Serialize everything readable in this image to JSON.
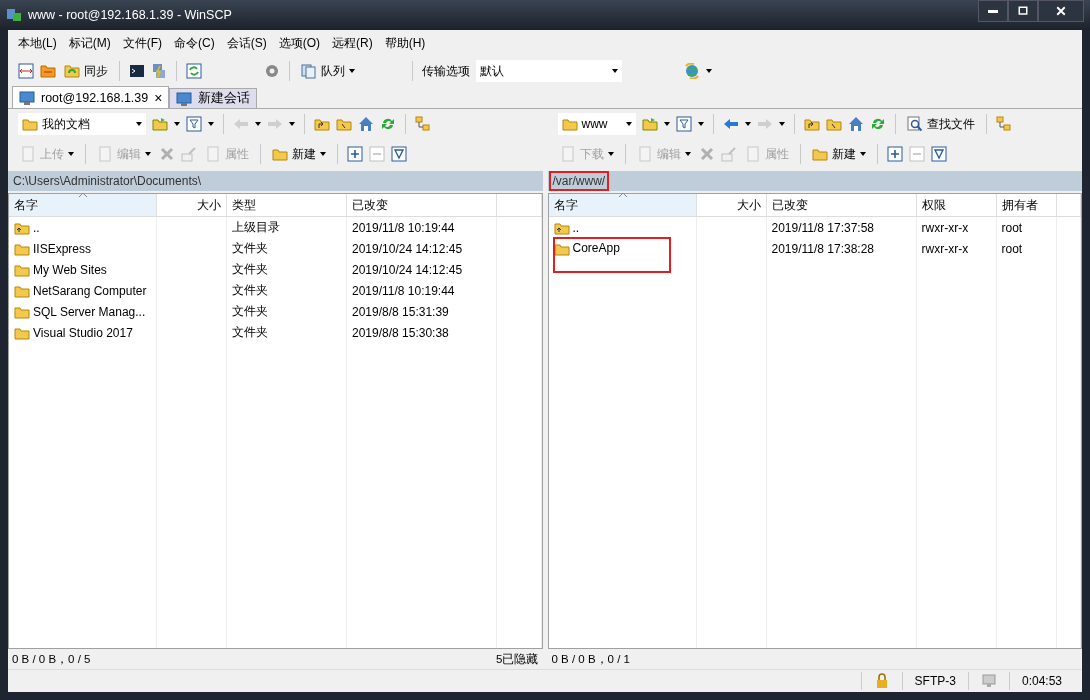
{
  "window": {
    "title": "www - root@192.168.1.39 - WinSCP"
  },
  "menu": [
    "本地(L)",
    "标记(M)",
    "文件(F)",
    "命令(C)",
    "会话(S)",
    "选项(O)",
    "远程(R)",
    "帮助(H)"
  ],
  "toolbar": {
    "sync_label": "同步",
    "queue_label": "队列",
    "transfer_label": "传输选项",
    "transfer_value": "默认"
  },
  "session_tabs": [
    {
      "label": "root@192.168.1.39",
      "selected": true,
      "closable": true,
      "close_glyph": "×"
    },
    {
      "label": "新建会话",
      "selected": false,
      "closable": false
    }
  ],
  "panels": [
    {
      "location": "我的文档",
      "back_disabled": true,
      "actions": [
        {
          "label": "上传",
          "disabled": true
        },
        {
          "label": "编辑",
          "disabled": true
        },
        {
          "label": "属性",
          "disabled": true
        },
        {
          "label": "新建",
          "disabled": false
        }
      ],
      "path": "C:\\Users\\Administrator\\Documents\\",
      "path_highlighted": false,
      "columns": [
        {
          "label": "名字",
          "kind": "name",
          "sorted": true
        },
        {
          "label": "大小",
          "kind": "size",
          "sorted": false
        },
        {
          "label": "类型",
          "kind": "type",
          "sorted": false
        },
        {
          "label": "已改变",
          "kind": "date",
          "sorted": false
        }
      ],
      "rows": [
        {
          "kind": "parent",
          "highlighted": false,
          "cells": [
            "..",
            "",
            "上级目录",
            "2019/11/8  10:19:44"
          ]
        },
        {
          "kind": "folder",
          "highlighted": false,
          "cells": [
            "IISExpress",
            "",
            "文件夹",
            "2019/10/24  14:12:45"
          ]
        },
        {
          "kind": "folder",
          "highlighted": false,
          "cells": [
            "My Web Sites",
            "",
            "文件夹",
            "2019/10/24  14:12:45"
          ]
        },
        {
          "kind": "folder",
          "highlighted": false,
          "cells": [
            "NetSarang Computer",
            "",
            "文件夹",
            "2019/11/8  10:19:44"
          ]
        },
        {
          "kind": "folder",
          "highlighted": false,
          "cells": [
            "SQL Server Manag...",
            "",
            "文件夹",
            "2019/8/8  15:31:39"
          ]
        },
        {
          "kind": "folder",
          "highlighted": false,
          "cells": [
            "Visual Studio 2017",
            "",
            "文件夹",
            "2019/8/8  15:30:38"
          ]
        }
      ],
      "status": "0 B / 0 B，0 / 5",
      "hidden_note": "5已隐藏"
    },
    {
      "location": "www",
      "back_disabled": false,
      "find_label": "查找文件",
      "actions": [
        {
          "label": "下载",
          "disabled": true
        },
        {
          "label": "编辑",
          "disabled": true
        },
        {
          "label": "属性",
          "disabled": true
        },
        {
          "label": "新建",
          "disabled": false
        }
      ],
      "path": "/var/www/",
      "path_highlighted": true,
      "columns": [
        {
          "label": "名字",
          "kind": "name",
          "sorted": true
        },
        {
          "label": "大小",
          "kind": "size",
          "sorted": false
        },
        {
          "label": "已改变",
          "kind": "date",
          "sorted": false
        },
        {
          "label": "权限",
          "kind": "perm",
          "sorted": false
        },
        {
          "label": "拥有者",
          "kind": "owner",
          "sorted": false
        }
      ],
      "rows": [
        {
          "kind": "parent",
          "highlighted": false,
          "cells": [
            "..",
            "",
            "2019/11/8 17:37:58",
            "rwxr-xr-x",
            "root"
          ]
        },
        {
          "kind": "folder",
          "highlighted": true,
          "cells": [
            "CoreApp",
            "",
            "2019/11/8 17:38:28",
            "rwxr-xr-x",
            "root"
          ]
        }
      ],
      "status": "0 B / 0 B，0 / 1"
    }
  ],
  "status_bar": {
    "protocol": "SFTP-3",
    "time": "0:04:53"
  }
}
